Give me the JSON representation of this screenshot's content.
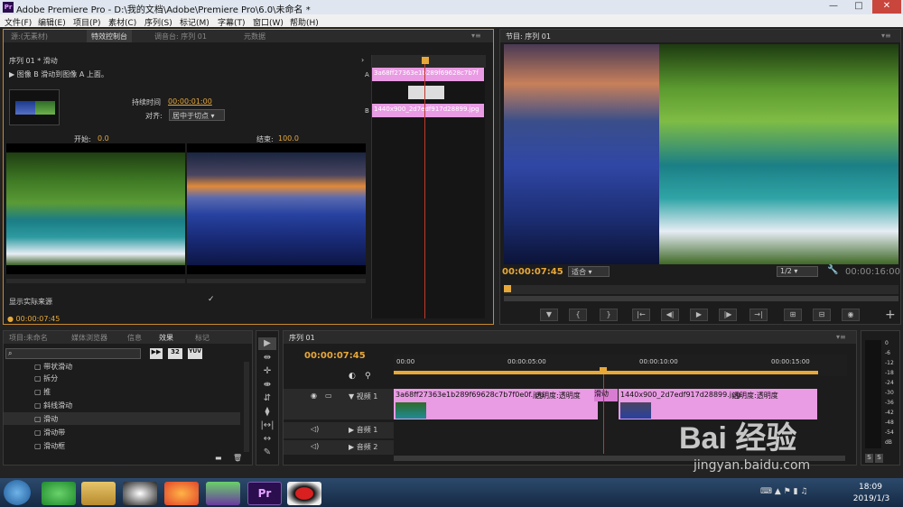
{
  "window": {
    "title": "Adobe Premiere Pro - D:\\我的文档\\Adobe\\Premiere Pro\\6.0\\未命名 *",
    "app_icon": "Pr",
    "min": "—",
    "max": "□",
    "close": "✕"
  },
  "menu": [
    "文件(F)",
    "编辑(E)",
    "项目(P)",
    "素材(C)",
    "序列(S)",
    "标记(M)",
    "字幕(T)",
    "窗口(W)",
    "帮助(H)"
  ],
  "effect_panel": {
    "tabs": [
      "源:(无素材)",
      "特效控制台",
      "调音台: 序列 01",
      "元数据"
    ],
    "header": "序列 01 * 滑动",
    "description": "图像 B 滑动到图像 A 上面。",
    "duration_label": "持续时间",
    "duration_value": "00:00:01:00",
    "align_label": "对齐:",
    "align_value": "居中于切点",
    "start_label": "开始:",
    "start_value": "0.0",
    "end_label": "结束:",
    "end_value": "100.0",
    "show_source_label": "显示实际来源",
    "show_source_check": "✓",
    "timecode": "00:00:07:45",
    "mini_clip_a": "3a68ff27363e1b289f69628c7b7f",
    "mini_clip_b": "1440x900_2d7edf917d28899.jpg",
    "mini_a": "A",
    "mini_b": "B"
  },
  "program_monitor": {
    "tab": "节目: 序列 01",
    "timecode": "00:00:07:45",
    "fit": "适合",
    "scale": "1/2",
    "duration": "00:00:16:00",
    "controls": [
      "▼",
      "{",
      "}",
      "|←",
      "◀|",
      "▶",
      "|▶",
      "→|",
      "⊞",
      "⊟",
      "◉"
    ],
    "add": "+"
  },
  "project_panel": {
    "tabs": [
      "项目:未命名",
      "媒体浏览器",
      "信息",
      "效果",
      "标记"
    ],
    "items": [
      "带状滑动",
      "拆分",
      "推",
      "斜线滑动",
      "滑动",
      "滑动带",
      "滑动框"
    ],
    "badges": [
      "32",
      "YUV"
    ]
  },
  "tools": [
    "▶",
    "⇹",
    "✛",
    "⇼",
    "⇵",
    "⧫",
    "|↔|",
    "↔",
    "✎",
    "✋",
    "🔍"
  ],
  "timeline": {
    "tab": "序列 01",
    "timecode": "00:00:07:45",
    "ruler": [
      "00:00",
      "00:00:05:00",
      "00:00:10:00",
      "00:00:15:00"
    ],
    "video_track": "视频 1",
    "audio_tracks": [
      "音频 1",
      "音频 2"
    ],
    "clip1_name": "3a68ff27363e1b289f69628c7b7f0e0f.jpg",
    "clip1_fx": "透明度:透明度",
    "transition": "滑动",
    "clip2_name": "1440x900_2d7edf917d28899.jpg",
    "clip2_fx": "透明度:透明度"
  },
  "meter": {
    "scale": [
      "0",
      "-6",
      "-12",
      "-18",
      "-24",
      "-30",
      "-36",
      "-42",
      "-48",
      "-54",
      "dB"
    ],
    "solo": [
      "S",
      "S"
    ]
  },
  "taskbar": {
    "time": "18:09",
    "date": "2019/1/3"
  },
  "watermark": {
    "text": "Bai 经验",
    "url": "jingyan.baidu.com"
  }
}
